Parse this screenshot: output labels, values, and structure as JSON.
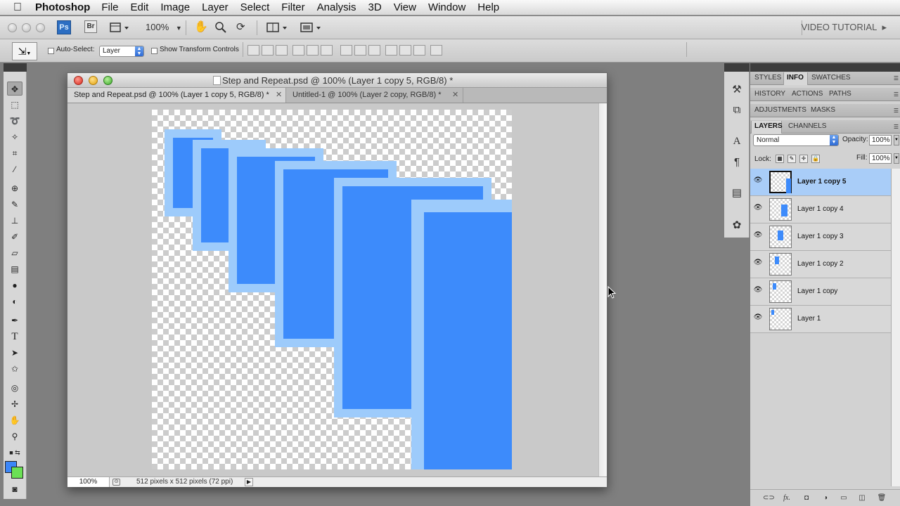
{
  "menubar": {
    "apple": "",
    "app_name": "Photoshop",
    "menus": [
      "File",
      "Edit",
      "Image",
      "Layer",
      "Select",
      "Filter",
      "Analysis",
      "3D",
      "View",
      "Window",
      "Help"
    ]
  },
  "appbar": {
    "ps_logo": "Ps",
    "br_logo": "Br",
    "zoom": "100%",
    "workspace": "VIDEO TUTORIAL"
  },
  "options": {
    "auto_select_label": "Auto-Select:",
    "auto_select_value": "Layer",
    "show_transform_label": "Show Transform Controls"
  },
  "document": {
    "window_title": "Step and Repeat.psd @ 100% (Layer 1 copy 5, RGB/8) *",
    "tabs": [
      {
        "label": "Step and Repeat.psd @ 100% (Layer 1 copy 5, RGB/8) *",
        "close": "✕"
      },
      {
        "label": "Untitled-1 @ 100% (Layer 2 copy, RGB/8) *",
        "close": "✕"
      }
    ],
    "status_zoom": "100%",
    "status_info": "512 pixels x 512 pixels (72 ppi)",
    "status_arrow": "▶",
    "fill_color": "#3d8bfb",
    "stroke_color": "#9dcbfb"
  },
  "tools": {
    "foreground": "#3b86f8",
    "background": "#6be055"
  },
  "panels": {
    "group1": [
      "STYLES",
      "INFO",
      "SWATCHES"
    ],
    "group2": [
      "HISTORY",
      "ACTIONS",
      "PATHS"
    ],
    "group3": [
      "ADJUSTMENTS",
      "MASKS"
    ],
    "group4": [
      "LAYERS",
      "CHANNELS"
    ],
    "blend_mode": "Normal",
    "opacity_label": "Opacity:",
    "opacity_value": "100%",
    "lock_label": "Lock:",
    "fill_label": "Fill:",
    "fill_value": "100%",
    "layers": [
      {
        "name": "Layer 1 copy 5",
        "selected": true
      },
      {
        "name": "Layer 1 copy 4",
        "selected": false
      },
      {
        "name": "Layer 1 copy 3",
        "selected": false
      },
      {
        "name": "Layer 1 copy 2",
        "selected": false
      },
      {
        "name": "Layer 1 copy",
        "selected": false
      },
      {
        "name": "Layer 1",
        "selected": false
      }
    ],
    "footer_icons": [
      "link-icon",
      "fx-icon",
      "mask-icon",
      "adjustment-icon",
      "group-icon",
      "new-layer-icon",
      "trash-icon"
    ],
    "fx_label": "fx."
  }
}
